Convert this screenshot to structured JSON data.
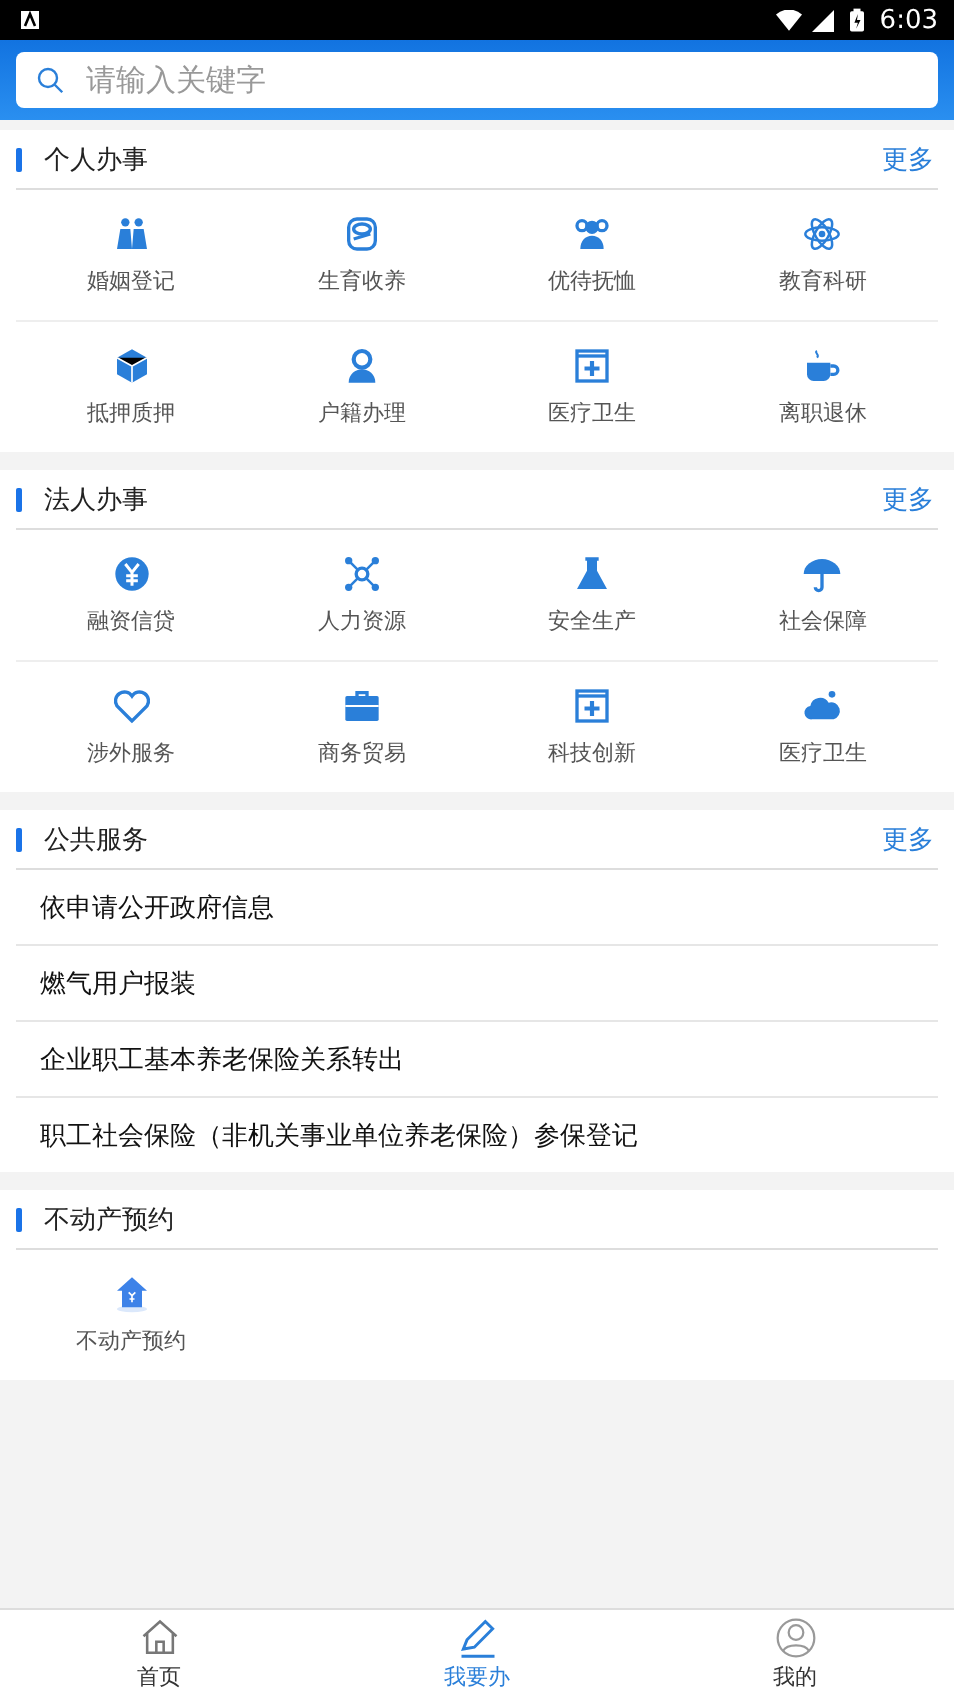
{
  "status_bar": {
    "time": "6:03"
  },
  "search": {
    "placeholder": "请输入关键字"
  },
  "sections": [
    {
      "title": "个人办事",
      "more": "更多",
      "kind": "grid",
      "items": [
        {
          "label": "婚姻登记"
        },
        {
          "label": "生育收养"
        },
        {
          "label": "优待抚恤"
        },
        {
          "label": "教育科研"
        },
        {
          "label": "抵押质押"
        },
        {
          "label": "户籍办理"
        },
        {
          "label": "医疗卫生"
        },
        {
          "label": "离职退休"
        }
      ]
    },
    {
      "title": "法人办事",
      "more": "更多",
      "kind": "grid",
      "items": [
        {
          "label": "融资信贷"
        },
        {
          "label": "人力资源"
        },
        {
          "label": "安全生产"
        },
        {
          "label": "社会保障"
        },
        {
          "label": "涉外服务"
        },
        {
          "label": "商务贸易"
        },
        {
          "label": "科技创新"
        },
        {
          "label": "医疗卫生"
        }
      ]
    },
    {
      "title": "公共服务",
      "more": "更多",
      "kind": "list",
      "items": [
        {
          "label": "依申请公开政府信息"
        },
        {
          "label": "燃气用户报装"
        },
        {
          "label": "企业职工基本养老保险关系转出"
        },
        {
          "label": "职工社会保险（非机关事业单位养老保险）参保登记"
        }
      ]
    },
    {
      "title": "不动产预约",
      "kind": "grid",
      "items": [
        {
          "label": "不动产预约"
        }
      ]
    }
  ],
  "bottom_nav": [
    {
      "label": "首页",
      "selected": false
    },
    {
      "label": "我要办",
      "selected": true
    },
    {
      "label": "我的",
      "selected": false
    }
  ]
}
